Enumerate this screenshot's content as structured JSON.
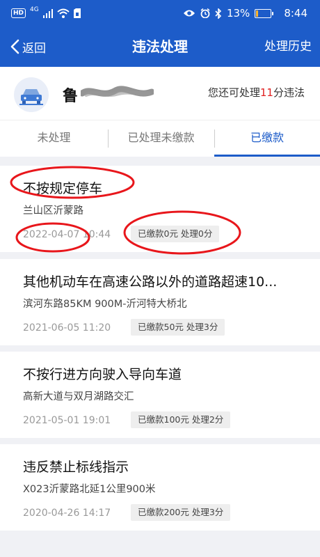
{
  "status": {
    "hd": "HD",
    "network": "4G",
    "battery": "13%",
    "battery_level": 0.13,
    "time": "8:44",
    "icons": [
      "signal-icon",
      "wifi-icon",
      "sim-icon",
      "eye-icon",
      "alarm-icon",
      "bluetooth-icon",
      "battery-icon"
    ]
  },
  "nav": {
    "back": "返回",
    "title": "违法处理",
    "history": "处理历史"
  },
  "car": {
    "plate": "鲁",
    "remain_prefix": "您还可处理",
    "remain_points": "11",
    "remain_suffix": "分违法"
  },
  "tabs": [
    "未处理",
    "已处理未缴款",
    "已缴款"
  ],
  "active_tab": "已缴款",
  "records": [
    {
      "title": "不按规定停车",
      "location": "兰山区沂蒙路",
      "time": "2022-04-07 10:44",
      "badge": "已缴款0元 处理0分"
    },
    {
      "title": "其他机动车在高速公路以外的道路超速10...",
      "location": "滨河东路85KM 900M-沂河特大桥北",
      "time": "2021-06-05 11:20",
      "badge": "已缴款50元 处理3分"
    },
    {
      "title": "不按行进方向驶入导向车道",
      "location": "高新大道与双月湖路交汇",
      "time": "2021-05-01 19:01",
      "badge": "已缴款100元 处理2分"
    },
    {
      "title": "违反禁止标线指示",
      "location": "X023沂蒙路北延1公里900米",
      "time": "2020-04-26 14:17",
      "badge": "已缴款200元 处理3分"
    }
  ],
  "colors": {
    "primary": "#1d5cc9",
    "highlight": "#e02020",
    "annotation": "#e8161b"
  }
}
